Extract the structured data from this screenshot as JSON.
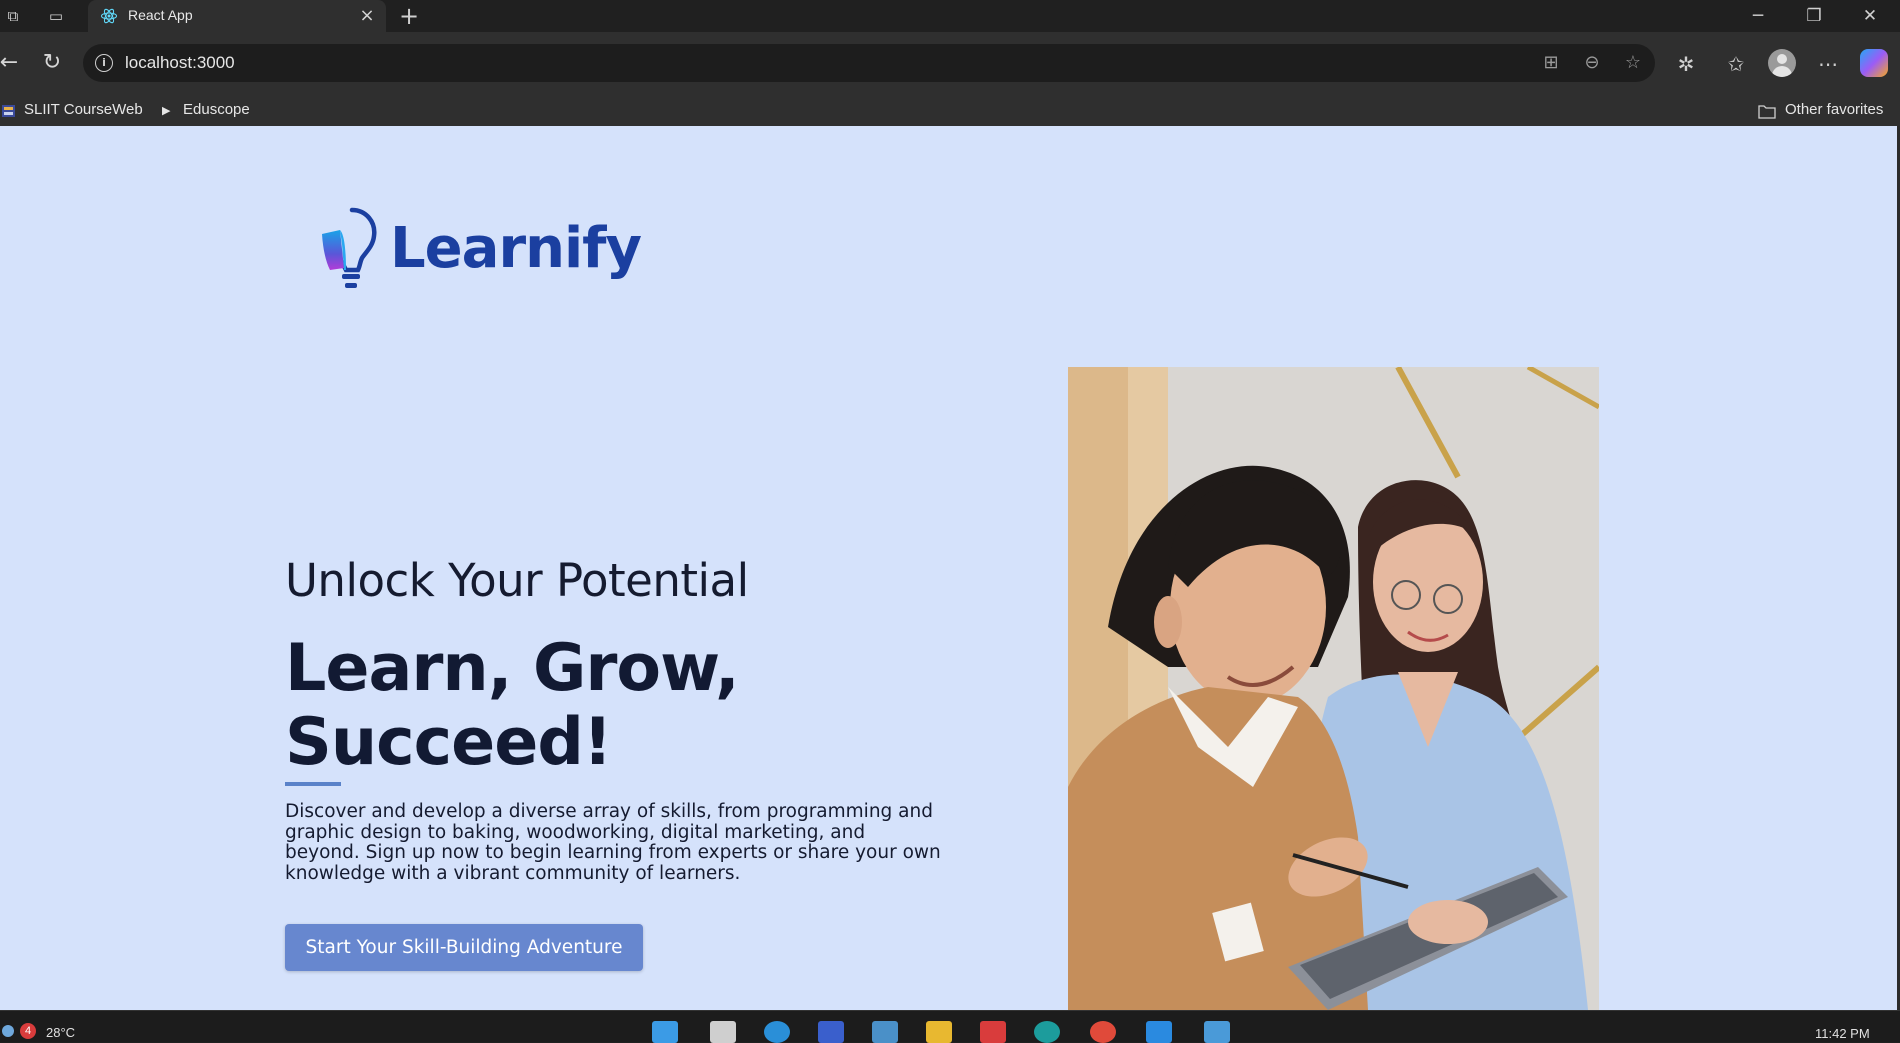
{
  "browser": {
    "tab_title": "React App",
    "url": "localhost:3000",
    "favorites": [
      {
        "label": "SLIIT CourseWeb"
      },
      {
        "label": "Eduscope"
      }
    ],
    "other_favorites": "Other favorites"
  },
  "page": {
    "logo_text": "Learnify",
    "eyebrow": "Unlock Your Potential",
    "headline": "Learn, Grow, Succeed!",
    "description": "Discover and develop a diverse array of skills, from programming and graphic design to baking, woodworking, digital marketing, and beyond. Sign up now to begin learning from experts or share your own knowledge with a vibrant community of learners.",
    "cta_label": "Start Your Skill-Building Adventure",
    "colors": {
      "background": "#d5e2fb",
      "brand": "#1b3fa0",
      "cta": "#6787cf",
      "text": "#121a33"
    }
  },
  "taskbar": {
    "weather": "28°C",
    "weather_badge": "4",
    "clock": "11:42 PM"
  }
}
